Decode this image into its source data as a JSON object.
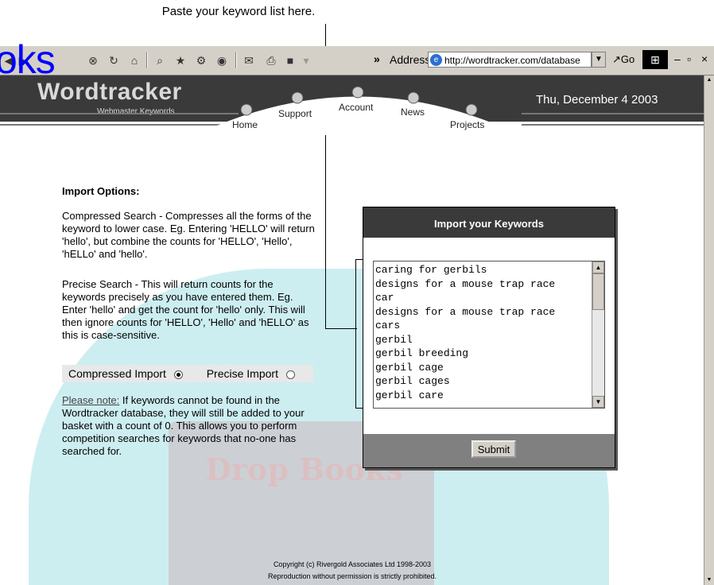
{
  "callout": {
    "text": "Paste your keyword list here."
  },
  "browser": {
    "logo_overlay": "oks",
    "toolbar_more": "»",
    "address_label": "Address",
    "address_value": "http://wordtracker.com/database",
    "go_label": "Go",
    "icons": [
      "back-icon",
      "forward-icon",
      "stop-icon",
      "refresh-icon",
      "home-icon",
      "search-icon",
      "favorites-icon",
      "history-icon",
      "media-icon",
      "mail-icon",
      "print-icon",
      "edit-icon"
    ]
  },
  "site": {
    "title": "Wordtracker",
    "subtitle": "Webmaster Keywords",
    "date": "Thu, December 4 2003",
    "nav": [
      "Home",
      "Support",
      "Account",
      "News",
      "Projects"
    ]
  },
  "content": {
    "heading": "Import Options:",
    "compressed_desc": "Compressed Search - Compresses all the forms of the keyword to lower case. Eg. Entering 'HELLO' will return 'hello', but combine the counts for 'HELLO', 'Hello', 'hELLo' and 'hello'.",
    "precise_desc": "Precise Search - This will return counts for the keywords precisely as you have entered them. Eg. Enter 'hello' and get the count for 'hello' only. This will then ignore counts for 'HELLO', 'Hello' and 'hELLO' as this is case-sensitive.",
    "radio_compressed": "Compressed Import",
    "radio_precise": "Precise Import",
    "note_link": "Please note:",
    "note_text": " If keywords cannot be found in the Wordtracker database, they will still be added to your basket with a count of 0. This allows you to perform competition searches for keywords that no-one has searched for."
  },
  "panel": {
    "title": "Import your Keywords",
    "keywords": [
      "caring for gerbils",
      "designs for a mouse trap race",
      "car",
      "designs for a mouse trap race",
      "cars",
      "gerbil",
      "gerbil breeding",
      "gerbil cage",
      "gerbil cages",
      "gerbil care"
    ],
    "submit": "Submit"
  },
  "footer": {
    "copyright": "Copyright (c) Rivergold Associates Ltd 1998-2003",
    "rights": "Reproduction without permission is strictly prohibited."
  },
  "watermark": {
    "text": "Drop Books"
  }
}
